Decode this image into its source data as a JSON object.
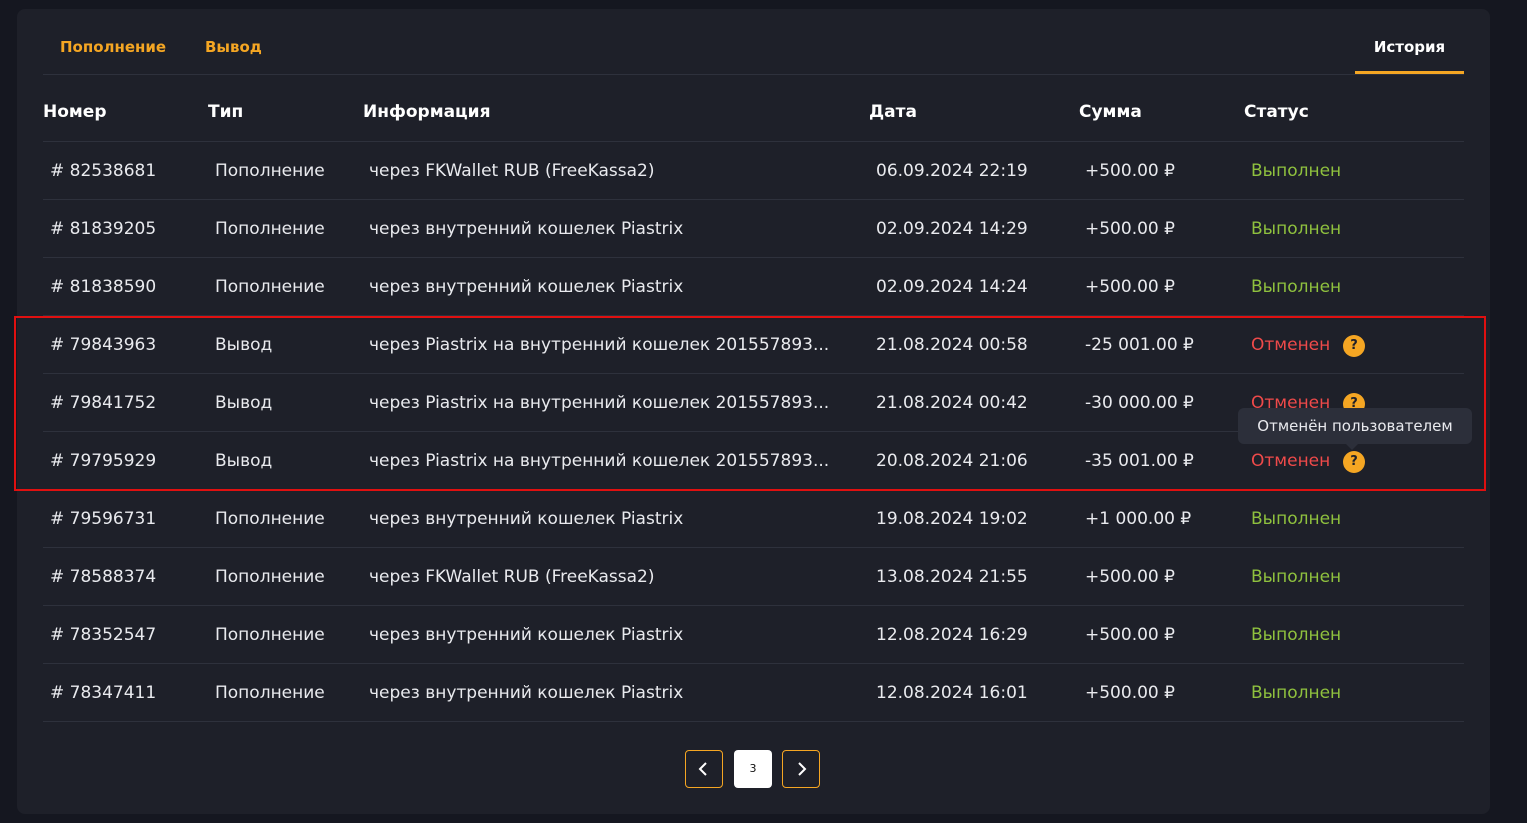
{
  "tabs": {
    "deposit": "Пополнение",
    "withdraw": "Вывод",
    "history": "История"
  },
  "table": {
    "headers": {
      "num": "Номер",
      "type": "Тип",
      "info": "Информация",
      "date": "Дата",
      "sum": "Сумма",
      "status": "Статус"
    },
    "rows": [
      {
        "num": "# 82538681",
        "type": "Пополнение",
        "info": "через FKWallet RUB (FreeKassa2)",
        "date": "06.09.2024 22:19",
        "sum": "+500.00 ₽",
        "status": "Выполнен"
      },
      {
        "num": "# 81839205",
        "type": "Пополнение",
        "info": "через внутренний кошелек Piastrix",
        "date": "02.09.2024 14:29",
        "sum": "+500.00 ₽",
        "status": "Выполнен"
      },
      {
        "num": "# 81838590",
        "type": "Пополнение",
        "info": "через внутренний кошелек Piastrix",
        "date": "02.09.2024 14:24",
        "sum": "+500.00 ₽",
        "status": "Выполнен"
      },
      {
        "num": "# 79843963",
        "type": "Вывод",
        "info": "через Piastrix на внутренний кошелек 201557893...",
        "date": "21.08.2024 00:58",
        "sum": "-25 001.00 ₽",
        "status": "Отменен"
      },
      {
        "num": "# 79841752",
        "type": "Вывод",
        "info": "через Piastrix на внутренний кошелек 201557893...",
        "date": "21.08.2024 00:42",
        "sum": "-30 000.00 ₽",
        "status": "Отменен"
      },
      {
        "num": "# 79795929",
        "type": "Вывод",
        "info": "через Piastrix на внутренний кошелек 201557893...",
        "date": "20.08.2024 21:06",
        "sum": "-35 001.00 ₽",
        "status": "Отменен"
      },
      {
        "num": "# 79596731",
        "type": "Пополнение",
        "info": "через внутренний кошелек Piastrix",
        "date": "19.08.2024 19:02",
        "sum": "+1 000.00 ₽",
        "status": "Выполнен"
      },
      {
        "num": "# 78588374",
        "type": "Пополнение",
        "info": "через FKWallet RUB (FreeKassa2)",
        "date": "13.08.2024 21:55",
        "sum": "+500.00 ₽",
        "status": "Выполнен"
      },
      {
        "num": "# 78352547",
        "type": "Пополнение",
        "info": "через внутренний кошелек Piastrix",
        "date": "12.08.2024 16:29",
        "sum": "+500.00 ₽",
        "status": "Выполнен"
      },
      {
        "num": "# 78347411",
        "type": "Пополнение",
        "info": "через внутренний кошелек Piastrix",
        "date": "12.08.2024 16:01",
        "sum": "+500.00 ₽",
        "status": "Выполнен"
      }
    ],
    "help_mark": "?"
  },
  "tooltip": {
    "text": "Отменён пользователем"
  },
  "pagination": {
    "current_page": "3"
  },
  "colors": {
    "accent": "#f5a623",
    "success": "#8fc13e",
    "danger": "#ef4a4a",
    "background": "#1e2029",
    "highlight_box": "#e01010"
  },
  "icons": {
    "prev": "chevron-left-icon",
    "next": "chevron-right-icon",
    "help": "question-icon"
  }
}
